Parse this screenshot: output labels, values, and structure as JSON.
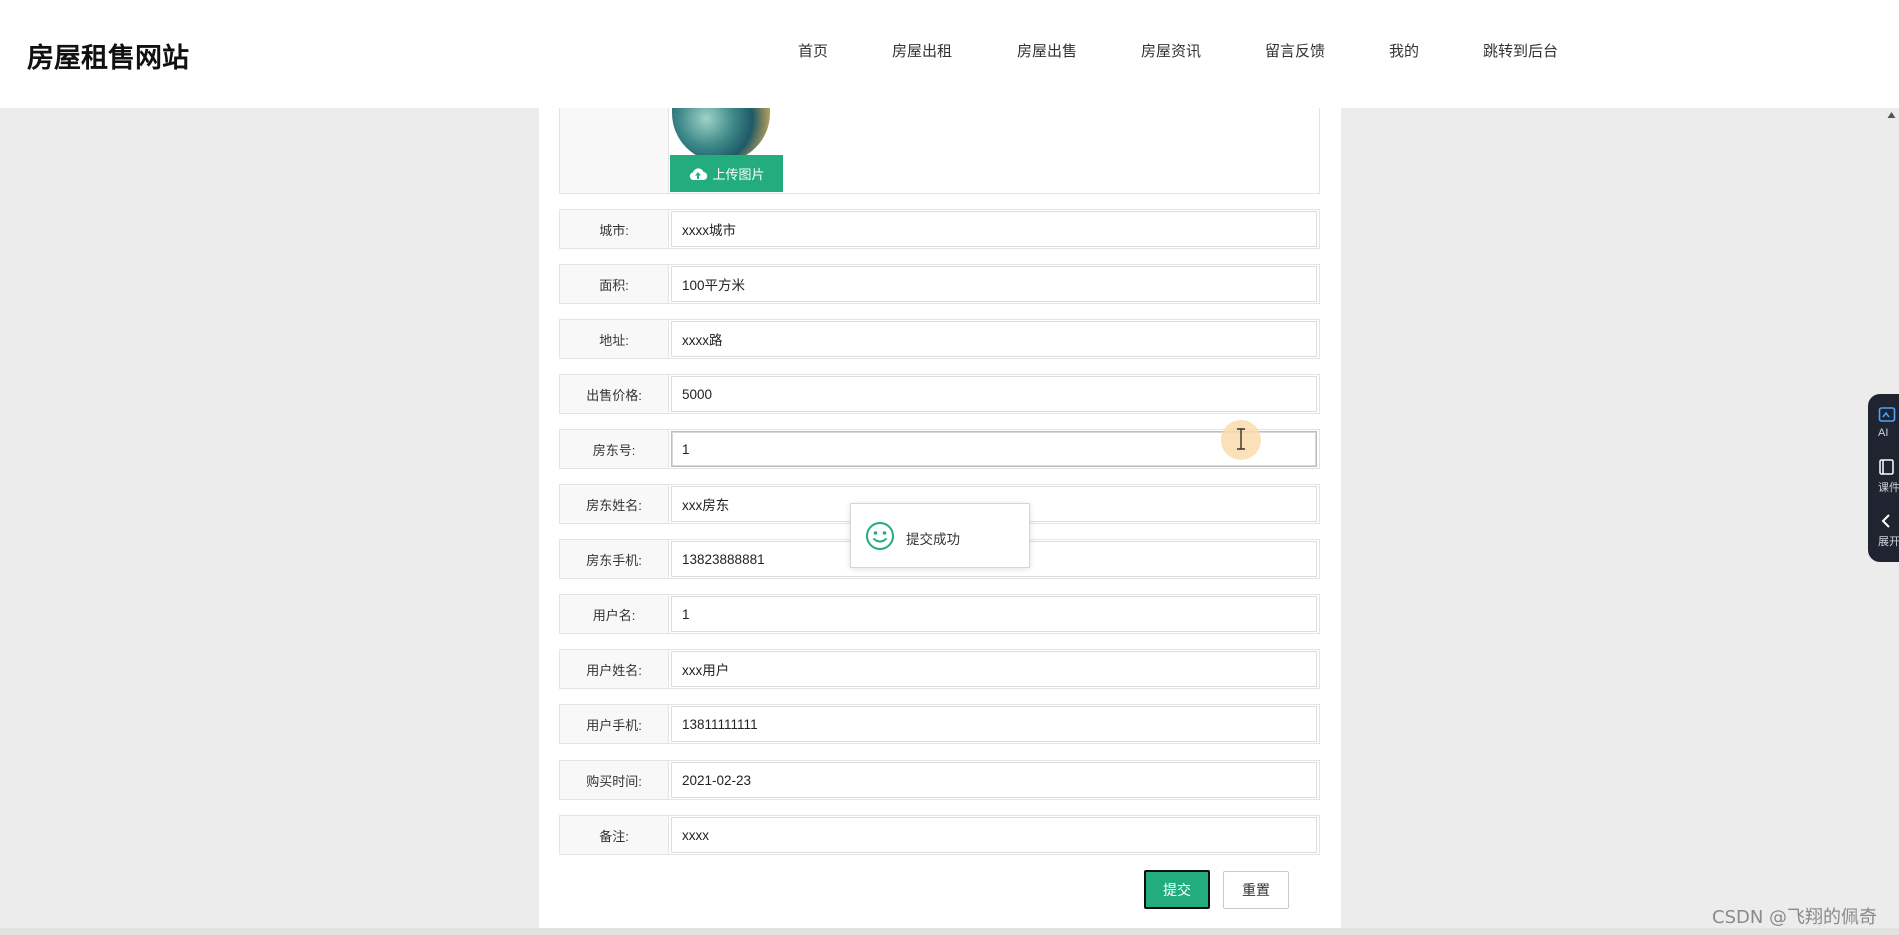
{
  "site": {
    "title": "房屋租售网站"
  },
  "nav": {
    "items": [
      {
        "label": "首页",
        "name": "nav-home"
      },
      {
        "label": "房屋出租",
        "name": "nav-rent"
      },
      {
        "label": "房屋出售",
        "name": "nav-sale"
      },
      {
        "label": "房屋资讯",
        "name": "nav-news"
      },
      {
        "label": "留言反馈",
        "name": "nav-feedback"
      },
      {
        "label": "我的",
        "name": "nav-mine"
      },
      {
        "label": "跳转到后台",
        "name": "nav-admin"
      }
    ]
  },
  "upload": {
    "button_label": "上传图片",
    "icon": "cloud-upload-icon"
  },
  "form": {
    "fields": [
      {
        "label": "城市:",
        "value": "xxxx城市"
      },
      {
        "label": "面积:",
        "value": "100平方米"
      },
      {
        "label": "地址:",
        "value": "xxxx路"
      },
      {
        "label": "出售价格:",
        "value": "5000"
      },
      {
        "label": "房东号:",
        "value": "1"
      },
      {
        "label": "房东姓名:",
        "value": "xxx房东"
      },
      {
        "label": "房东手机:",
        "value": "13823888881"
      },
      {
        "label": "用户名:",
        "value": "1"
      },
      {
        "label": "用户姓名:",
        "value": "xxx用户"
      },
      {
        "label": "用户手机:",
        "value": "13811111111"
      },
      {
        "label": "购买时间:",
        "value": "2021-02-23"
      },
      {
        "label": "备注:",
        "value": "xxxx"
      }
    ],
    "submit_label": "提交",
    "reset_label": "重置"
  },
  "toast": {
    "message": "提交成功",
    "icon": "smile-icon"
  },
  "side_widget": {
    "items": [
      {
        "label": "AI",
        "icon": "ai-image-icon"
      },
      {
        "label": "课件",
        "icon": "book-icon"
      },
      {
        "label": "展开",
        "icon": "chevron-left-icon"
      }
    ]
  },
  "watermark": "CSDN @飞翔的佩奇",
  "colors": {
    "accent": "#23ad7e",
    "background": "#ececec",
    "panel": "#ffffff"
  }
}
